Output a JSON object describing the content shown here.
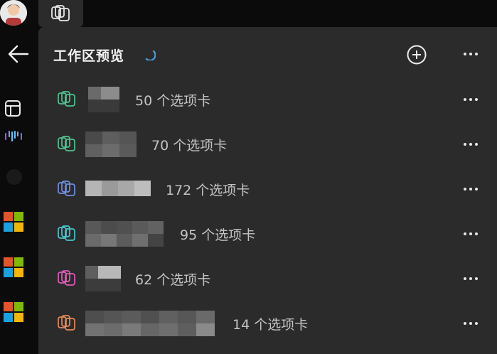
{
  "panel": {
    "title": "工作区预览"
  },
  "workspaces": [
    {
      "count_label": "50 个选项卡",
      "icon_color": "#4fc38f"
    },
    {
      "count_label": "70 个选项卡",
      "icon_color": "#4fc38f"
    },
    {
      "count_label": "172 个选项卡",
      "icon_color": "#6f8fe0"
    },
    {
      "count_label": "95 个选项卡",
      "icon_color": "#47c6cf"
    },
    {
      "count_label": "62 个选项卡",
      "icon_color": "#e05cb8"
    },
    {
      "count_label": "14 个选项卡",
      "icon_color": "#e58a5a"
    }
  ],
  "colors": {
    "panel_bg": "#2b2b2b",
    "page_bg": "#0b0b0b",
    "spinner": "#4aa3e0"
  },
  "icons": {
    "back": "arrow-left-icon",
    "add": "plus-circle-icon",
    "more": "more-horizontal-icon",
    "workspaces": "workspaces-icon"
  }
}
